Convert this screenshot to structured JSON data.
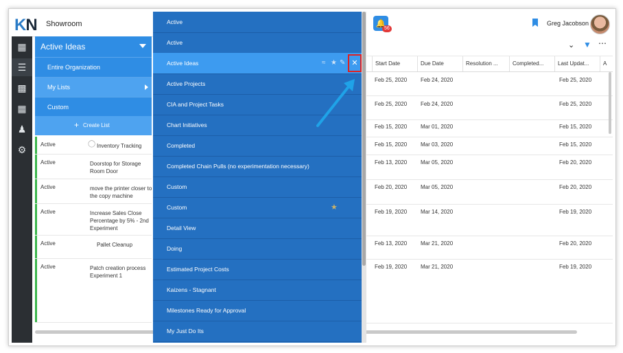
{
  "topbar": {
    "logo_k": "K",
    "logo_n": "N",
    "app_name": "Showroom",
    "notification_count": "56",
    "user_name": "Greg Jacobson"
  },
  "rail": {
    "icons": [
      "apps-grid-icon",
      "list-icon",
      "analytics-icon",
      "calendar-icon",
      "people-icon",
      "settings-gear-icon"
    ]
  },
  "list_panel": {
    "header": "Active Ideas",
    "items": [
      {
        "label": "Entire Organization"
      },
      {
        "label": "My Lists"
      },
      {
        "label": "Custom"
      }
    ],
    "create_label": "Create List"
  },
  "dropdown": {
    "items": [
      {
        "label": "Active"
      },
      {
        "label": "Active"
      },
      {
        "label": "Active Ideas"
      },
      {
        "label": "Active Projects"
      },
      {
        "label": "CIA and Project Tasks"
      },
      {
        "label": "Chart Initiatives"
      },
      {
        "label": "Completed"
      },
      {
        "label": "Completed Chain Pulls (no experimentation necessary)"
      },
      {
        "label": "Custom"
      },
      {
        "label": "Custom"
      },
      {
        "label": "Detail View"
      },
      {
        "label": "Doing"
      },
      {
        "label": "Estimated Project Costs"
      },
      {
        "label": "Kaizens - Stagnant"
      },
      {
        "label": "Milestones Ready for Approval"
      },
      {
        "label": "My Just Do Its"
      }
    ],
    "highlighted_item": "Active Ideas",
    "favorite_item_index": 9
  },
  "grid": {
    "columns": [
      "Start Date",
      "Due Date",
      "Resolution ...",
      "Completed...",
      "Last Updat...",
      "A"
    ],
    "rows": [
      {
        "status": "",
        "title": "",
        "start": "Feb 25, 2020",
        "due": "Feb 24, 2020",
        "updated": "Feb 25, 2020"
      },
      {
        "status": "",
        "title": "",
        "start": "Feb 25, 2020",
        "due": "Feb 24, 2020",
        "updated": "Feb 25, 2020"
      },
      {
        "status": "",
        "title": "",
        "start": "Feb 15, 2020",
        "due": "Mar 01, 2020",
        "updated": "Feb 15, 2020"
      },
      {
        "status": "Active",
        "title": "Inventory Tracking",
        "start": "Feb 15, 2020",
        "due": "Mar 03, 2020",
        "updated": "Feb 15, 2020"
      },
      {
        "status": "Active",
        "title": "Doorstop for Storage Room Door",
        "start": "Feb 13, 2020",
        "due": "Mar 05, 2020",
        "updated": "Feb 20, 2020"
      },
      {
        "status": "Active",
        "title": "move the printer closer to the copy machine",
        "start": "Feb 20, 2020",
        "due": "Mar 05, 2020",
        "updated": "Feb 20, 2020"
      },
      {
        "status": "Active",
        "title": "Increase Sales Close Percentage by 5% - 2nd Experiment",
        "start": "Feb 19, 2020",
        "due": "Mar 14, 2020",
        "updated": "Feb 19, 2020"
      },
      {
        "status": "Active",
        "title": "Pallet Cleanup",
        "start": "Feb 13, 2020",
        "due": "Mar 21, 2020",
        "updated": "Feb 20, 2020"
      },
      {
        "status": "Active",
        "title": "Patch creation process Experiment 1",
        "start": "Feb 19, 2020",
        "due": "Mar 21, 2020",
        "updated": "Feb 19, 2020"
      }
    ]
  },
  "colors": {
    "accent": "#2f8de4",
    "dropdown_bg": "#2470c1",
    "highlight": "#3d9bf0",
    "status_bar": "#39b54a",
    "close_outline": "#e02020",
    "pointer_arrow": "#1fa3e8"
  }
}
